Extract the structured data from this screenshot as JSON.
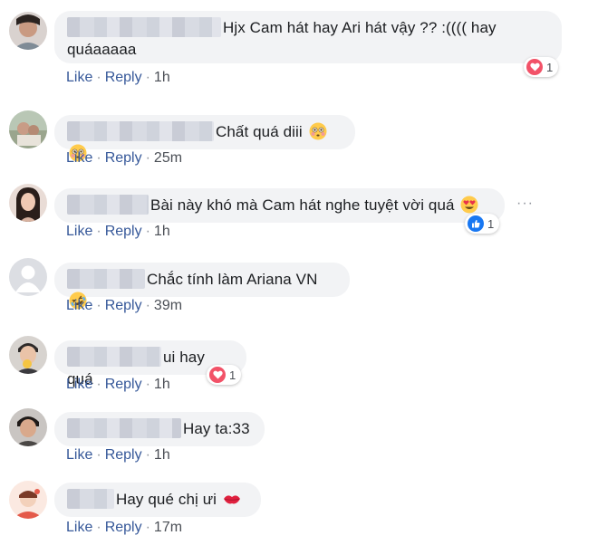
{
  "comments": [
    {
      "text": "Hjx Cam hát hay Ari hát vậy ?? :(((( hay quáaaaaa",
      "text_line1": "Hjx Cam hát hay Ari hát vậy ?? :(((( hay",
      "text_line2": "quáaaaaa",
      "like": "Like",
      "reply": "Reply",
      "time": "1h",
      "reaction": "heart",
      "reaction_count": "1"
    },
    {
      "text": "Chất quá diii",
      "emoji": "flushed-face",
      "like": "Like",
      "reply": "Reply",
      "time": "25m"
    },
    {
      "text": "Bài này khó mà Cam hát nghe tuyệt vời quá",
      "emoji": "heart-eyes-face",
      "like": "Like",
      "reply": "Reply",
      "time": "1h",
      "reaction": "like",
      "reaction_count": "1"
    },
    {
      "text": "Chắc tính làm Ariana VN",
      "emoji": "rolling-laughing-face",
      "like": "Like",
      "reply": "Reply",
      "time": "39m"
    },
    {
      "text": "ui hay quá",
      "like": "Like",
      "reply": "Reply",
      "time": "1h",
      "reaction": "heart",
      "reaction_count": "1"
    },
    {
      "text": "Hay ta:33",
      "like": "Like",
      "reply": "Reply",
      "time": "1h"
    },
    {
      "text": "Hay qué chị ưi",
      "emoji": "kiss-lips",
      "like": "Like",
      "reply": "Reply",
      "time": "17m"
    }
  ],
  "more_options": "···",
  "dot": "·",
  "colors": {
    "link": "#365899",
    "bubble": "#f2f3f5",
    "heart": "#f25268",
    "like": "#1877f2"
  }
}
